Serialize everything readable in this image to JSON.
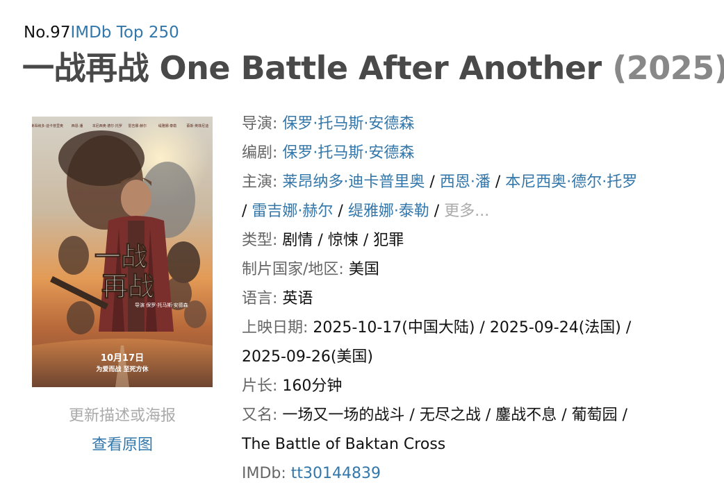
{
  "header": {
    "rank_no": "No.97",
    "rank_list": "IMDb Top 250",
    "title": "一战再战 One Battle After Another",
    "year": "(2025)"
  },
  "poster": {
    "icon": "movie-poster",
    "top_credits": [
      "莱昂纳多·迪卡普里奥",
      "西恩·潘",
      "本尼西奥·德尔·托罗",
      "雷吉娜·赫尔",
      "缇雅娜·泰勒",
      "蔡斯·英菲尼迪"
    ],
    "title_line1": "一战",
    "title_line2": "再战",
    "director_small": "导演 保罗·托马斯·安德森",
    "date": "10月17日",
    "tagline": "为爱而战 至死方休"
  },
  "poster_links": {
    "update": "更新描述或海报",
    "view_original": "查看原图"
  },
  "info": {
    "director_label": "导演",
    "director": "保罗·托马斯·安德森",
    "writer_label": "编剧",
    "writer": "保罗·托马斯·安德森",
    "cast_label": "主演",
    "cast": [
      "莱昂纳多·迪卡普里奥",
      "西恩·潘",
      "本尼西奥·德尔·托罗",
      "雷吉娜·赫尔",
      "缇雅娜·泰勒"
    ],
    "more": "更多...",
    "genre_label": "类型",
    "genres": "剧情 / 惊悚 / 犯罪",
    "country_label": "制片国家/地区",
    "country": "美国",
    "language_label": "语言",
    "language": "英语",
    "release_label": "上映日期",
    "release_line1": "2025-10-17(中国大陆) / 2025-09-24(法国) /",
    "release_line2": "2025-09-26(美国)",
    "runtime_label": "片长",
    "runtime": "160分钟",
    "aka_label": "又名",
    "aka_line1": "一场又一场的战斗 / 无尽之战 / 鏖战不息 / 葡萄园 /",
    "aka_line2": "The Battle of Baktan Cross",
    "imdb_label": "IMDb",
    "imdb_id": "tt30144839"
  },
  "colors": {
    "link": "#3377aa",
    "title": "#494949",
    "year": "#888888",
    "label": "#666666",
    "muted": "#aaaaaa"
  }
}
